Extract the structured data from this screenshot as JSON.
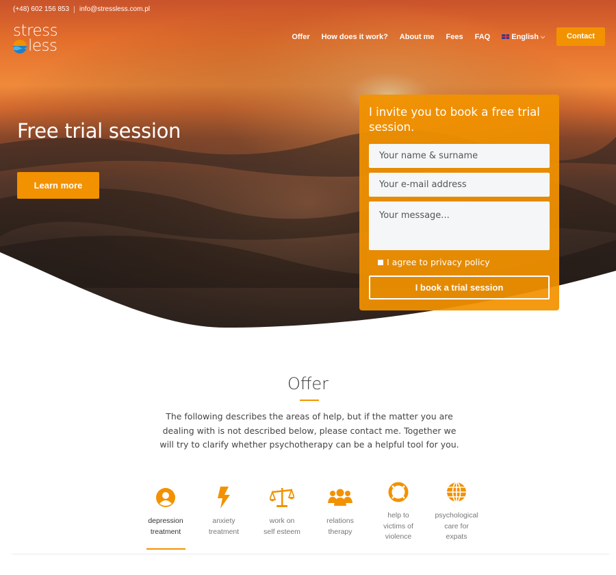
{
  "topbar": {
    "phone": "(+48) 602 156 853",
    "email": "info@stressless.com.pl"
  },
  "logo": {
    "line1": "stress",
    "line2": "less"
  },
  "nav": {
    "items": [
      "Offer",
      "How does it work?",
      "About me",
      "Fees",
      "FAQ"
    ],
    "language": "English",
    "contact": "Contact"
  },
  "hero": {
    "title": "Free trial session",
    "cta": "Learn more"
  },
  "form": {
    "title": "I invite you to book a free trial session.",
    "name_placeholder": "Your name & surname",
    "email_placeholder": "Your e-mail address",
    "message_placeholder": "Your message...",
    "agree_label": "I agree to privacy policy",
    "submit": "I book a trial session"
  },
  "offer": {
    "title": "Offer",
    "description": "The following describes the areas of help, but if the matter you are dealing with is not described below, please contact me. Together we will try to clarify whether psychotherapy can be a helpful tool for you.",
    "tabs": [
      {
        "line1": "depression",
        "line2": "treatment",
        "line3": "",
        "icon": "user-circle-icon",
        "active": true
      },
      {
        "line1": "anxiety",
        "line2": "treatment",
        "line3": "",
        "icon": "lightning-icon",
        "active": false
      },
      {
        "line1": "work on",
        "line2": "self esteem",
        "line3": "",
        "icon": "scales-icon",
        "active": false
      },
      {
        "line1": "relations",
        "line2": "therapy",
        "line3": "",
        "icon": "users-icon",
        "active": false
      },
      {
        "line1": "help to",
        "line2": "victims of",
        "line3": "violence",
        "icon": "lifebuoy-icon",
        "active": false
      },
      {
        "line1": "psychological",
        "line2": "care for",
        "line3": "expats",
        "icon": "globe-icon",
        "active": false
      }
    ]
  },
  "colors": {
    "accent": "#f29200",
    "hero_dark": "#1c1714",
    "hero_sky": "#e8662a"
  }
}
